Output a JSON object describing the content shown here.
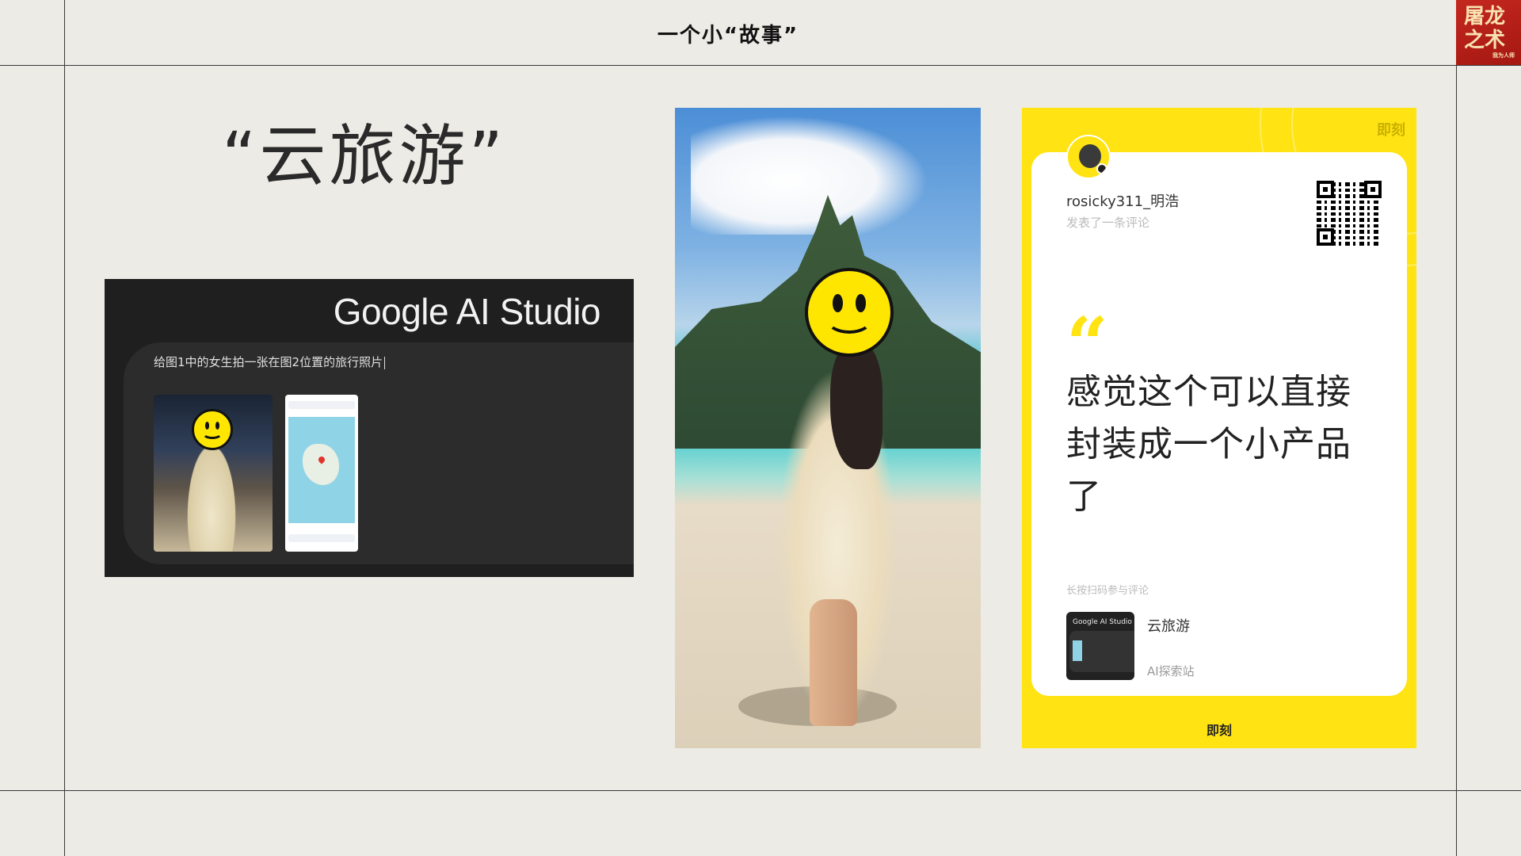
{
  "header": {
    "title": "一个小“故事”",
    "seal_text": "屠龙之术",
    "seal_small": "我为人师"
  },
  "slide": {
    "title": "“云旅游”"
  },
  "studio_card": {
    "logo": "Google AI Studio",
    "prompt": "给图1中的女生拍一张在图2位置的旅行照片"
  },
  "comment_card": {
    "brand": "即刻",
    "username": "rosicky311_明浩",
    "action": "发表了一条评论",
    "quote_mark": "“",
    "comment": "感觉这个可以直接封装成一个小产品了",
    "scan_hint": "长按扫码参与评论",
    "topic_thumb_logo": "Google AI Studio",
    "topic_title": "云旅游",
    "topic_subtitle": "AI探索站",
    "accent_color": "#ffe312"
  }
}
